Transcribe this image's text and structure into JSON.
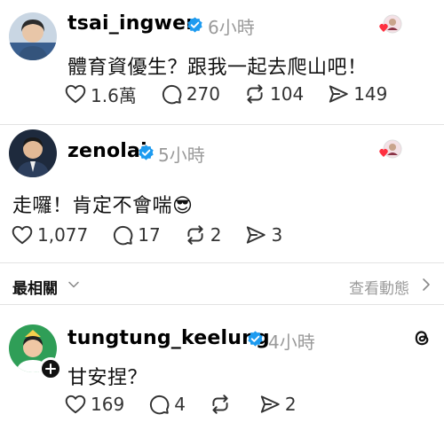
{
  "posts": [
    {
      "username": "tsai_ingwen",
      "time": "6小時",
      "text": "體育資優生？跟我一起去爬山吧！",
      "likes": "1.6萬",
      "replies": "270",
      "reposts": "104",
      "shares": "149"
    },
    {
      "username": "zenolai",
      "time": "5小時",
      "text": "走囉！肯定不會喘😎",
      "likes": "1,077",
      "replies": "17",
      "reposts": "2",
      "shares": "3"
    }
  ],
  "sort": {
    "label": "最相關",
    "view_activity": "查看動態"
  },
  "reply": {
    "username": "tungtung_keelung",
    "time": "4小時",
    "text": "甘安捏？",
    "likes": "169",
    "replies": "4",
    "reposts": "",
    "shares": "2"
  },
  "icons": {
    "like": "heart-icon",
    "reply": "comment-icon",
    "repost": "repost-icon",
    "share": "share-icon",
    "verified": "verified-badge-icon",
    "threads": "threads-logo-icon"
  },
  "colors": {
    "verified": "#1d9bf0",
    "heart": "#ff3040",
    "muted": "#9a9a9a"
  }
}
